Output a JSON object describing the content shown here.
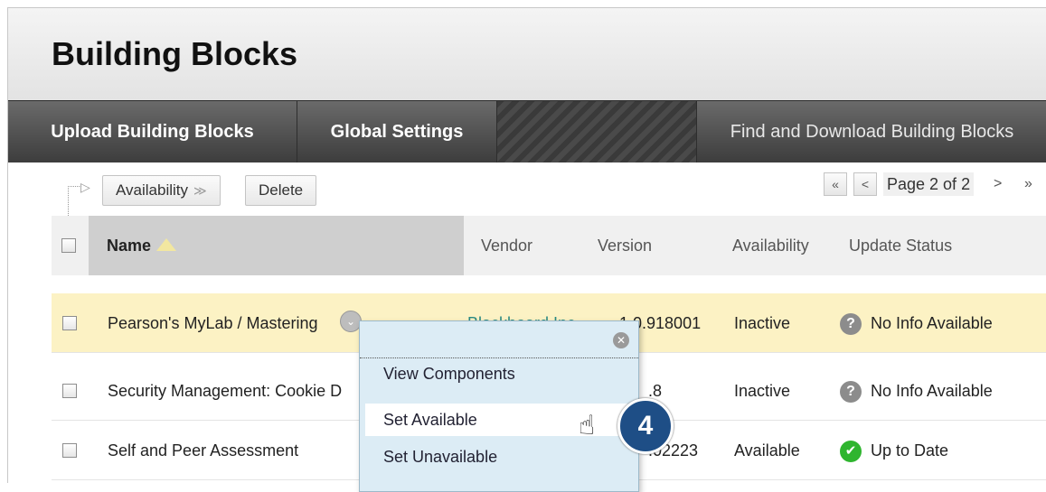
{
  "page": {
    "title": "Building Blocks"
  },
  "nav": {
    "items": [
      {
        "label": "Upload Building Blocks"
      },
      {
        "label": "Global Settings"
      },
      {
        "label": "Find and Download Building Blocks"
      }
    ]
  },
  "toolbar": {
    "availability_label": "Availability",
    "delete_label": "Delete"
  },
  "pager": {
    "first": "«",
    "prev": "<",
    "text": "Page 2 of 2",
    "next": ">",
    "last": "»"
  },
  "table": {
    "headers": {
      "name": "Name",
      "vendor": "Vendor",
      "version": "Version",
      "availability": "Availability",
      "update_status": "Update Status"
    },
    "rows": [
      {
        "name": "Pearson's MyLab / Mastering",
        "vendor": "Blackboard Inc",
        "version": "1.0.918001",
        "availability": "Inactive",
        "status": "No Info Available",
        "status_icon": "question-icon"
      },
      {
        "name": "Security Management: Cookie D",
        "vendor": "",
        "version": ".8",
        "availability": "Inactive",
        "status": "No Info Available",
        "status_icon": "question-icon"
      },
      {
        "name": "Self and Peer Assessment",
        "vendor": "",
        "version": ".02223",
        "availability": "Available",
        "status": "Up to Date",
        "status_icon": "check-icon"
      }
    ]
  },
  "context_menu": {
    "items": [
      {
        "label": "View Components"
      },
      {
        "label": "Set Available"
      },
      {
        "label": "Set Unavailable"
      }
    ]
  },
  "callout": {
    "step": "4"
  },
  "colors": {
    "highlight_row": "#fcf2c4",
    "menu_bg": "#dcecf5",
    "badge": "#1e4e86",
    "ok_green": "#2fb52f",
    "link": "#2a8a84"
  }
}
